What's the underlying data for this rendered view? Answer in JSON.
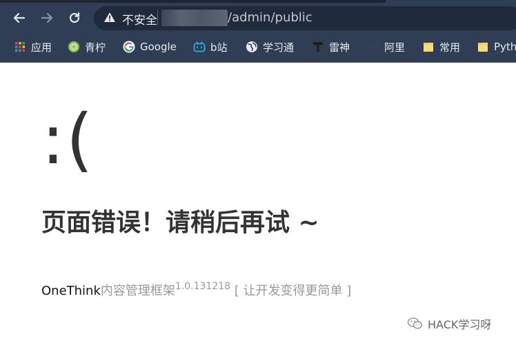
{
  "browser": {
    "nav": {
      "back_icon": "arrow-left-icon",
      "forward_icon": "arrow-right-icon",
      "reload_icon": "reload-icon"
    },
    "omnibox": {
      "security_label": "不安全",
      "url_path": "/admin/public"
    },
    "bookmarks": [
      {
        "label": "应用",
        "icon": "apps-grid-icon"
      },
      {
        "label": "青柠",
        "icon": "lime-icon"
      },
      {
        "label": "Google",
        "icon": "google-icon"
      },
      {
        "label": "b站",
        "icon": "bilibili-icon"
      },
      {
        "label": "学习通",
        "icon": "globe-icon"
      },
      {
        "label": "雷神",
        "icon": "hammer-icon"
      },
      {
        "label": "阿里",
        "icon": "alibaba-icon"
      },
      {
        "label": "常用",
        "icon": "folder-icon"
      },
      {
        "label": "Pyth",
        "icon": "folder-icon"
      }
    ]
  },
  "page": {
    "face": ":(",
    "error_message": "页面错误！请稍后再试 ~",
    "footer": {
      "brand": "OneThink",
      "product": "内容管理框架",
      "version": "1.0.131218",
      "slogan": " [ 让开发变得更简单 ]"
    }
  },
  "watermark": {
    "text": "HACK学习呀",
    "icon": "wechat-icon"
  },
  "colors": {
    "chrome_bg": "#2f3d55",
    "omnibox_bg": "#1f2a3c",
    "text_dark": "#333333",
    "text_muted": "#999999"
  }
}
